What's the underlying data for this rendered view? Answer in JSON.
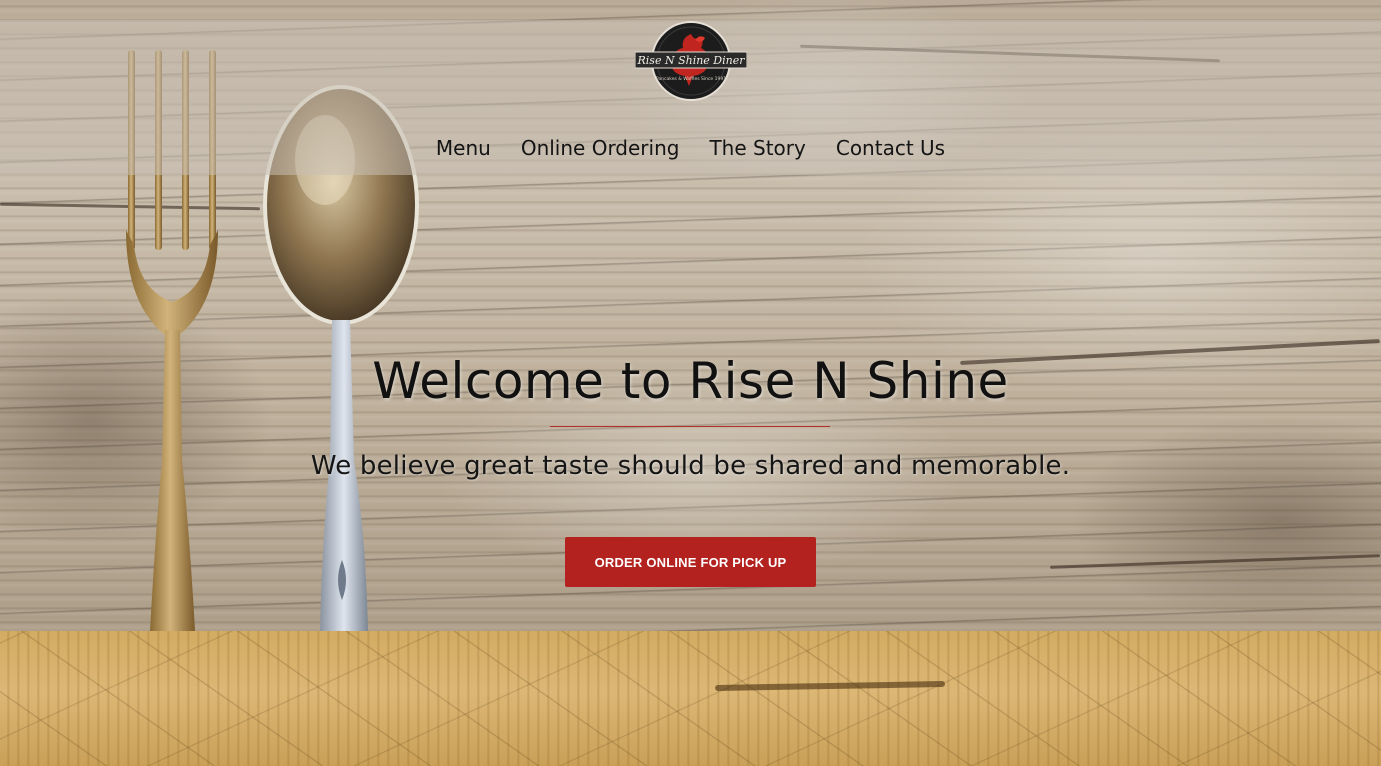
{
  "brand": {
    "logo_text": "Rise N Shine Diner",
    "logo_tagline": "Pancakes & Waffles Since 1991",
    "icon": "rooster-logo-icon",
    "accent_color": "#b3221f"
  },
  "nav": {
    "items": [
      {
        "label": "Menu"
      },
      {
        "label": "Online Ordering"
      },
      {
        "label": "The Story"
      },
      {
        "label": "Contact Us"
      }
    ]
  },
  "hero": {
    "title": "Welcome to Rise N Shine",
    "subtitle": "We believe great taste should be shared and memorable.",
    "cta_label": "ORDER ONLINE FOR PICK UP"
  }
}
